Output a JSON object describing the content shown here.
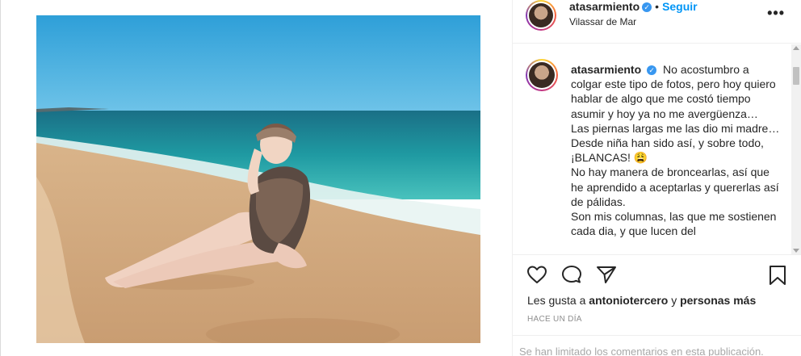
{
  "header": {
    "username": "atasarmiento",
    "separator": "•",
    "follow_label": "Seguir",
    "location": "Vilassar de Mar",
    "more_label": "•••"
  },
  "caption": {
    "username": "atasarmiento",
    "lines": [
      "No acostumbro a colgar este tipo de fotos, pero hoy quiero hablar de algo que me costó tiempo asumir y hoy ya no me avergüenza…",
      "Las piernas largas me las dio mi madre…Desde niña han sido así, y sobre todo, ¡BLANCAS! 😩",
      "No hay manera de broncearlas, así que he aprendido a aceptarlas y quererlas así de pálidas.",
      "Son mis columnas, las que me sostienen cada dia, y que lucen del"
    ]
  },
  "actions": {
    "like_icon": "heart-icon",
    "comment_icon": "comment-icon",
    "share_icon": "paper-plane-icon",
    "save_icon": "bookmark-icon"
  },
  "likes": {
    "prefix": "Les gusta a",
    "user": "antoniotercero",
    "connector": "y",
    "others": "personas más"
  },
  "timestamp": "HACE UN DÍA",
  "comments_limit": "Se han limitado los comentarios en esta publicación.",
  "colors": {
    "accent": "#0095f6",
    "verified": "#3897f0",
    "muted": "#8e8e8e"
  }
}
